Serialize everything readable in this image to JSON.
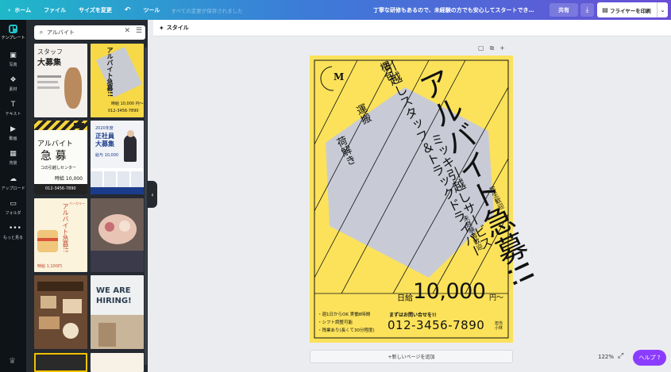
{
  "topbar": {
    "home": "ホーム",
    "file": "ファイル",
    "resize": "サイズを変更",
    "undo_icon": "undo-arrow",
    "tools": "ツール",
    "autosave": "すべての変更が保存されました",
    "ticker": "丁寧な研修もあるので、未経験の方でも安心してスタートでき…",
    "share": "共有",
    "download_icon": "download-arrow",
    "print": "フライヤーを印刷"
  },
  "rail": {
    "items": [
      {
        "label": "テンプレート",
        "icon": "template-icon"
      },
      {
        "label": "写真",
        "icon": "photo-icon"
      },
      {
        "label": "素材",
        "icon": "elements-icon"
      },
      {
        "label": "テキスト",
        "icon": "text-icon"
      },
      {
        "label": "動画",
        "icon": "video-icon"
      },
      {
        "label": "背景",
        "icon": "background-icon"
      },
      {
        "label": "アップロード",
        "icon": "upload-icon"
      },
      {
        "label": "フォルダ",
        "icon": "folder-icon"
      },
      {
        "label": "もっと見る",
        "icon": "more-icon"
      }
    ]
  },
  "search": {
    "value": "アルバイト"
  },
  "thumbs": [
    {
      "line1": "スタッフ",
      "line2": "大募集"
    },
    {
      "line1": "アルバイト急募!!",
      "price": "時給 10,000 円〜",
      "phone": "012-3456-7890"
    },
    {
      "line1": "アルバイト",
      "line2": "急 募",
      "center": "コの引越しセンター",
      "price": "時給 10,000",
      "phone": "012-3456-7890"
    },
    {
      "line1": "2020年度",
      "line2": "正社員",
      "line3": "大募集",
      "price": "給与 10,000"
    },
    {
      "line1": "アルバイト急募!!",
      "price": "時給 1,100円",
      "tag": "ベーカリー"
    },
    {
      "line1": ""
    },
    {
      "line1": ""
    },
    {
      "line1": "WE ARE",
      "line2": "HIRING!"
    }
  ],
  "style_toolbar": {
    "label": "スタイル"
  },
  "flyer": {
    "logo": "M",
    "title": "アルバイト急募!!",
    "company": "ミッキ引越しサービス",
    "job1": "引越しスタッフ＆トラックドライバー",
    "task1": "梱包",
    "task2": "運搬",
    "task3": "荷解き",
    "welcome1": "学生歓迎",
    "welcome2": "未経験者歓迎",
    "wage_label": "日給",
    "wage_value": "10,000",
    "wage_unit": "円〜",
    "bullets": [
      "週1日からOK 実働8時間",
      "シフト調整可能",
      "残業あり(長くて30分程度)"
    ],
    "contact_label": "まずはお問い合せを!!",
    "phone": "012-3456-7890",
    "contact_person": "担当 小林"
  },
  "add_page": "+新しいページを追加",
  "zoom": "122%",
  "help": "ヘルプ ?"
}
